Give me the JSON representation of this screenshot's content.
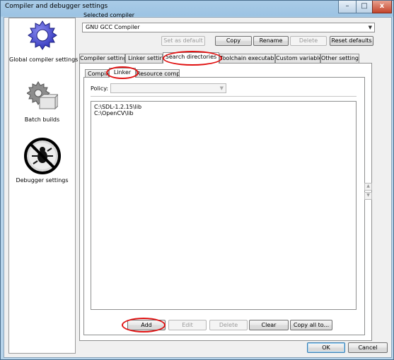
{
  "window": {
    "title": "Compiler and debugger settings",
    "caption_buttons": {
      "minimize": "–",
      "maximize": "□",
      "close": "x"
    }
  },
  "sidebar": {
    "items": [
      {
        "label": "Global compiler settings",
        "icon": "gear-icon"
      },
      {
        "label": "Batch builds",
        "icon": "gear-box-icon"
      },
      {
        "label": "Debugger settings",
        "icon": "no-bug-icon"
      }
    ]
  },
  "compiler": {
    "selected_label": "Selected compiler",
    "selected_value": "GNU GCC Compiler",
    "buttons": {
      "set_default": "Set as default",
      "copy": "Copy",
      "rename": "Rename",
      "delete": "Delete",
      "reset_defaults": "Reset defaults"
    }
  },
  "tabs": {
    "main": [
      "Compiler settings",
      "Linker settings",
      "Search directories",
      "Toolchain executables",
      "Custom variables",
      "Other settings"
    ],
    "active_main": "Search directories",
    "sub": [
      "Compiler",
      "Linker",
      "Resource compiler"
    ],
    "active_sub": "Linker"
  },
  "policy": {
    "label": "Policy:",
    "value": ""
  },
  "directories": [
    "C:\\SDL-1.2.15\\lib",
    "C:\\OpenCV\\lib"
  ],
  "list_buttons": {
    "add": "Add",
    "edit": "Edit",
    "delete": "Delete",
    "clear": "Clear",
    "copy_all": "Copy all to..."
  },
  "dialog_buttons": {
    "ok": "OK",
    "cancel": "Cancel"
  },
  "spin_glyphs": {
    "up": "▲",
    "down": "▼"
  },
  "colors": {
    "highlight_ellipse": "#e01010",
    "title_bar": "#9cc3e3"
  }
}
